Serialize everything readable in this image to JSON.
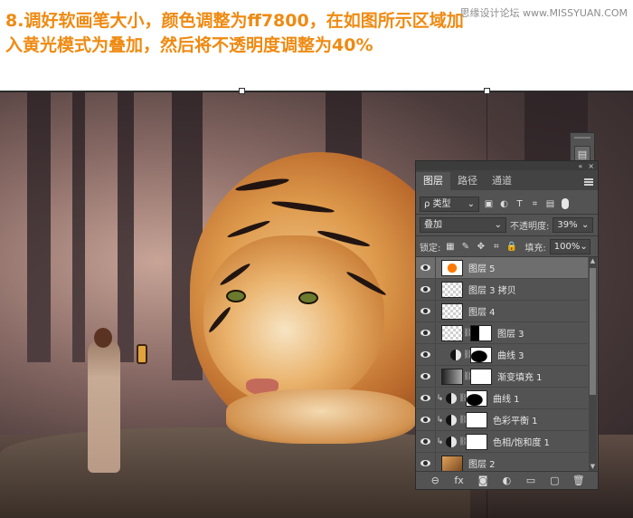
{
  "instruction": {
    "text": "8.调好软画笔大小，颜色调整为ff7800，在如图所示区域加入黄光模式为叠加，然后将不透明度调整为40%",
    "color": "#ef8a12"
  },
  "watermark": "思缘设计论坛 www.MISSYUAN.COM",
  "ui_icons": {
    "mini_collapse": "«",
    "mini_close": "×",
    "mini_panel_button": "▤",
    "panel_collapse": "«",
    "panel_close": "×",
    "scroll_up": "▲",
    "scroll_down": "▼",
    "chevron_down": "⌄",
    "link": "⛓",
    "clip_arrow": "↳"
  },
  "layers_panel": {
    "tabs": [
      {
        "label": "图层",
        "active": true
      },
      {
        "label": "路径",
        "active": false
      },
      {
        "label": "通道",
        "active": false
      }
    ],
    "filter": {
      "kind_label": "ρ 类型",
      "icons": [
        "▣",
        "◐",
        "T",
        "⌗",
        "▤"
      ]
    },
    "blend_mode": "叠加",
    "opacity_label": "不透明度:",
    "opacity_value": "39%",
    "lock_label": "锁定:",
    "lock_icons": [
      "▦",
      "✎",
      "✥",
      "⌗",
      "🔒"
    ],
    "fill_label": "填充:",
    "fill_value": "100%",
    "layers": [
      {
        "name": "图层 5",
        "thumb": "orange",
        "selected": true
      },
      {
        "name": "图层 3 拷贝",
        "thumb": "checker"
      },
      {
        "name": "图层 4",
        "thumb": "checker"
      },
      {
        "name": "图层 3",
        "thumb": "checker",
        "mask": "mixed"
      },
      {
        "name": "曲线 3",
        "adjustment": true,
        "mask": "curve"
      },
      {
        "name": "渐变填充 1",
        "thumb": "gradient",
        "mask": "white"
      },
      {
        "name": "曲线 1",
        "adjustment": true,
        "clipped": true,
        "mask": "curve"
      },
      {
        "name": "色彩平衡 1",
        "adjustment": true,
        "clipped": true,
        "mask": "white"
      },
      {
        "name": "色相/饱和度 1",
        "adjustment": true,
        "clipped": true,
        "mask": "white"
      },
      {
        "name": "图层 2",
        "thumb": "tiger"
      }
    ],
    "bottom_icons": [
      "⊖",
      "fx",
      "◙",
      "◐",
      "▭",
      "▢",
      "🗑"
    ]
  }
}
